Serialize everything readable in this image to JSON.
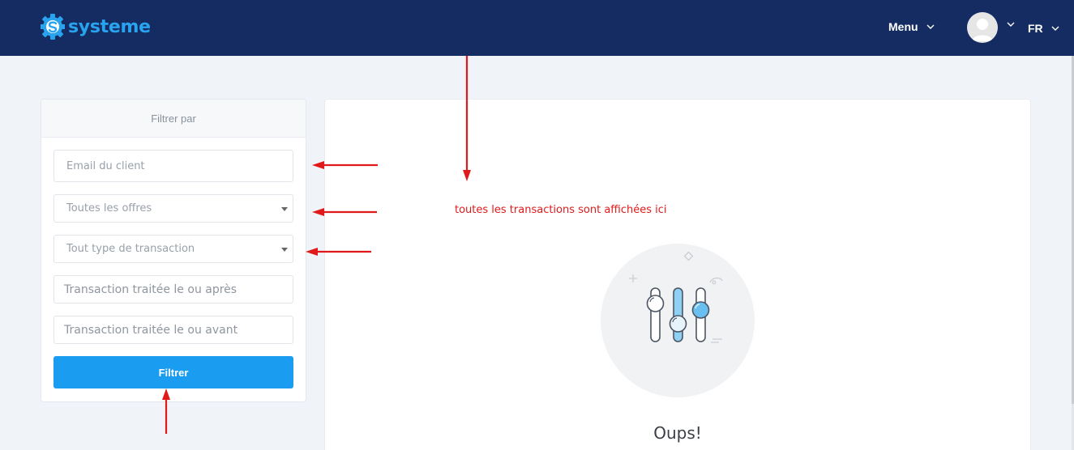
{
  "header": {
    "brand": "systeme",
    "menu_label": "Menu",
    "language": "FR"
  },
  "filter": {
    "title": "Filtrer par",
    "email_placeholder": "Email du client",
    "offers_select": "Toutes les offres",
    "transaction_type_select": "Tout type de transaction",
    "processed_after_placeholder": "Transaction traitée le ou après",
    "processed_before_placeholder": "Transaction traitée le ou avant",
    "submit_label": "Filtrer"
  },
  "main": {
    "annotation": "toutes les transactions sont affichées ici",
    "empty_title": "Oups!"
  },
  "colors": {
    "header_bg": "#142c62",
    "brand_blue": "#29a3ee",
    "button_blue": "#1a9cf0",
    "annotation_red": "#e01a1a"
  },
  "icons": [
    "logo-gear-icon",
    "chevron-down-icon",
    "user-avatar-icon",
    "sliders-icon",
    "red-arrow"
  ]
}
